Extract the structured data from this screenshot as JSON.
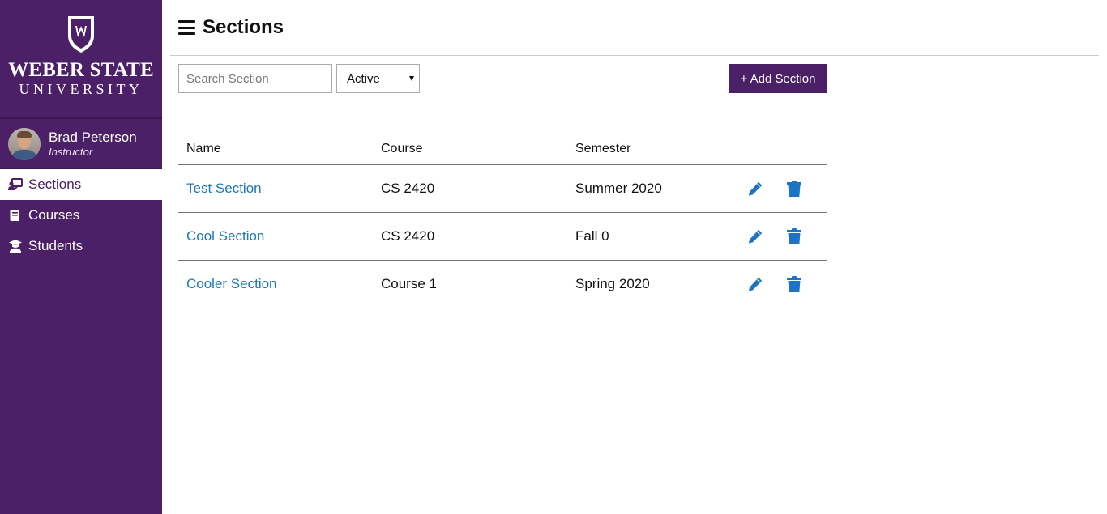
{
  "sidebar": {
    "logo_line1": "WEBER STATE",
    "logo_line2": "UNIVERSITY",
    "user": {
      "name": "Brad Peterson",
      "role": "Instructor"
    },
    "nav": [
      {
        "label": "Sections",
        "icon": "chalkboard-teacher-icon",
        "active": true
      },
      {
        "label": "Courses",
        "icon": "book-icon",
        "active": false
      },
      {
        "label": "Students",
        "icon": "graduate-icon",
        "active": false
      }
    ]
  },
  "header": {
    "title": "Sections"
  },
  "toolbar": {
    "search_placeholder": "Search Section",
    "status_selected": "Active",
    "add_label": "+ Add Section"
  },
  "table": {
    "columns": [
      "Name",
      "Course",
      "Semester"
    ],
    "rows": [
      {
        "name": "Test Section",
        "course": "CS 2420",
        "semester": "Summer 2020"
      },
      {
        "name": "Cool Section",
        "course": "CS 2420",
        "semester": "Fall 0"
      },
      {
        "name": "Cooler Section",
        "course": "Course 1",
        "semester": "Spring 2020"
      }
    ]
  },
  "colors": {
    "brand_purple": "#4b2066",
    "link_blue": "#1e78b4",
    "action_blue": "#1e74c4"
  }
}
